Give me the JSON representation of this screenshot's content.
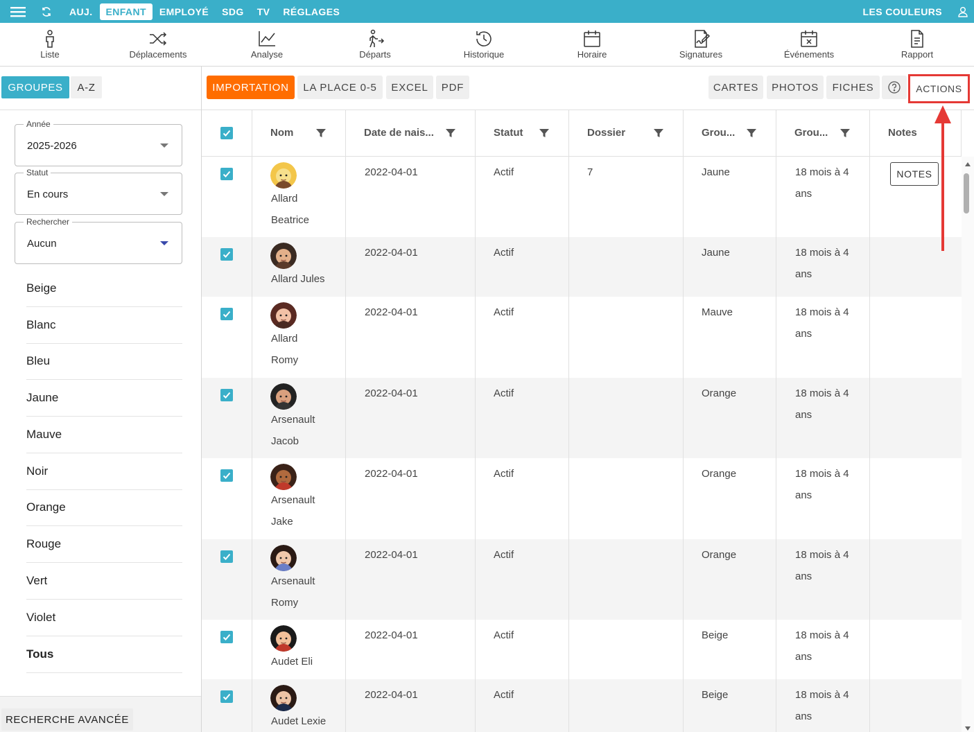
{
  "topbar": {
    "tabs": [
      "AUJ.",
      "ENFANT",
      "EMPLOYÉ",
      "SDG",
      "TV",
      "RÉGLAGES"
    ],
    "active_tab": "ENFANT",
    "org_name": "LES COULEURS"
  },
  "iconnav": {
    "items": [
      "Liste",
      "Déplacements",
      "Analyse",
      "Départs",
      "Historique",
      "Horaire",
      "Signatures",
      "Événements",
      "Rapport"
    ]
  },
  "sidebar": {
    "toggle": {
      "groups": "GROUPES",
      "az": "A-Z"
    },
    "year": {
      "label": "Année",
      "value": "2025-2026"
    },
    "status": {
      "label": "Statut",
      "value": "En cours"
    },
    "search": {
      "label": "Rechercher",
      "value": "Aucun"
    },
    "groups": [
      "Beige",
      "Blanc",
      "Bleu",
      "Jaune",
      "Mauve",
      "Noir",
      "Orange",
      "Rouge",
      "Vert",
      "Violet",
      "Tous"
    ],
    "advanced_search": "RECHERCHE AVANCÉE"
  },
  "toolbar": {
    "import": "IMPORTATION",
    "laplace": "LA PLACE 0-5",
    "excel": "EXCEL",
    "pdf": "PDF",
    "cards": "CARTES",
    "photos": "PHOTOS",
    "sheets": "FICHES",
    "actions": "ACTIONS"
  },
  "table": {
    "columns": [
      "Nom",
      "Date de nais...",
      "Statut",
      "Dossier",
      "Grou...",
      "Grou...",
      "Notes"
    ],
    "notes_button": "NOTES",
    "rows": [
      {
        "name1": "Allard",
        "name2": "Beatrice",
        "dob": "2022-04-01",
        "status": "Actif",
        "dossier": "7",
        "group": "Jaune",
        "age1": "18 mois à 4",
        "age2": "ans",
        "notes": true
      },
      {
        "name1": "Allard Jules",
        "name2": "",
        "dob": "2022-04-01",
        "status": "Actif",
        "dossier": "",
        "group": "Jaune",
        "age1": "18 mois à 4",
        "age2": "ans",
        "notes": false
      },
      {
        "name1": "Allard",
        "name2": "Romy",
        "dob": "2022-04-01",
        "status": "Actif",
        "dossier": "",
        "group": "Mauve",
        "age1": "18 mois à 4",
        "age2": "ans",
        "notes": false
      },
      {
        "name1": "Arsenault",
        "name2": "Jacob",
        "dob": "2022-04-01",
        "status": "Actif",
        "dossier": "",
        "group": "Orange",
        "age1": "18 mois à 4",
        "age2": "ans",
        "notes": false
      },
      {
        "name1": "Arsenault",
        "name2": "Jake",
        "dob": "2022-04-01",
        "status": "Actif",
        "dossier": "",
        "group": "Orange",
        "age1": "18 mois à 4",
        "age2": "ans",
        "notes": false
      },
      {
        "name1": "Arsenault",
        "name2": "Romy",
        "dob": "2022-04-01",
        "status": "Actif",
        "dossier": "",
        "group": "Orange",
        "age1": "18 mois à 4",
        "age2": "ans",
        "notes": false
      },
      {
        "name1": "Audet Eli",
        "name2": "",
        "dob": "2022-04-01",
        "status": "Actif",
        "dossier": "",
        "group": "Beige",
        "age1": "18 mois à 4",
        "age2": "ans",
        "notes": false
      },
      {
        "name1": "Audet Lexie",
        "name2": "",
        "dob": "2022-04-01",
        "status": "Actif",
        "dossier": "",
        "group": "Beige",
        "age1": "18 mois à 4",
        "age2": "ans",
        "notes": false
      }
    ]
  },
  "colors": {
    "accent": "#3aafc9",
    "orange": "#ff6d00",
    "highlight": "#e53935"
  }
}
